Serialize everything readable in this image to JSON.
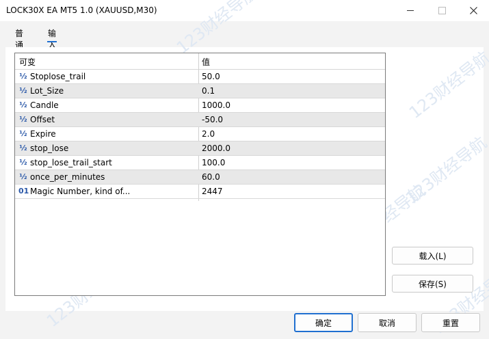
{
  "window": {
    "title": "LOCK30X EA MT5 1.0 (XAUUSD,M30)"
  },
  "tabs": [
    {
      "label": "普通"
    },
    {
      "label": "输入"
    }
  ],
  "table": {
    "headers": [
      "可变",
      "值"
    ],
    "rows": [
      {
        "icon": "½",
        "name": "Stoplose_trail",
        "value": "50.0"
      },
      {
        "icon": "½",
        "name": "Lot_Size",
        "value": "0.1"
      },
      {
        "icon": "½",
        "name": "Candle",
        "value": "1000.0"
      },
      {
        "icon": "½",
        "name": "Offset",
        "value": "-50.0"
      },
      {
        "icon": "½",
        "name": "Expire",
        "value": "2.0"
      },
      {
        "icon": "½",
        "name": "stop_lose",
        "value": "2000.0"
      },
      {
        "icon": "½",
        "name": "stop_lose_trail_start",
        "value": "100.0"
      },
      {
        "icon": "½",
        "name": "once_per_minutes",
        "value": "60.0"
      },
      {
        "icon": "01",
        "name": "Magic Number, kind of...",
        "value": "2447"
      }
    ]
  },
  "side_buttons": {
    "load": "载入(L)",
    "save": "保存(S)"
  },
  "footer": {
    "ok": "确定",
    "cancel": "取消",
    "reset": "重置"
  },
  "watermark": "123财经导航",
  "colors": {
    "accent": "#1f6fd0",
    "row_alt": "#e8e8e8",
    "param_icon": "#2a58a8"
  }
}
